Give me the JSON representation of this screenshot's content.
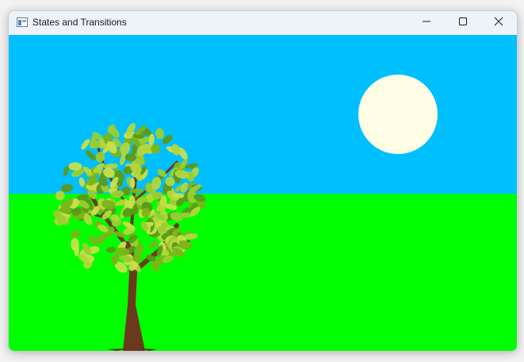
{
  "window": {
    "title": "States and Transitions",
    "icon": "app-window-icon",
    "controls": {
      "minimize_icon": "minimize-icon",
      "maximize_icon": "maximize-icon",
      "close_icon": "close-icon"
    }
  },
  "scene": {
    "sky_color": "#00bfff",
    "grass_color": "#00ff00",
    "sun_color": "#fffde4",
    "trunk_color": "#6b3a1e",
    "leaf_colors": [
      "#9acd32",
      "#7cb518",
      "#b5d63b",
      "#5a9a1a",
      "#c8e04a"
    ]
  }
}
